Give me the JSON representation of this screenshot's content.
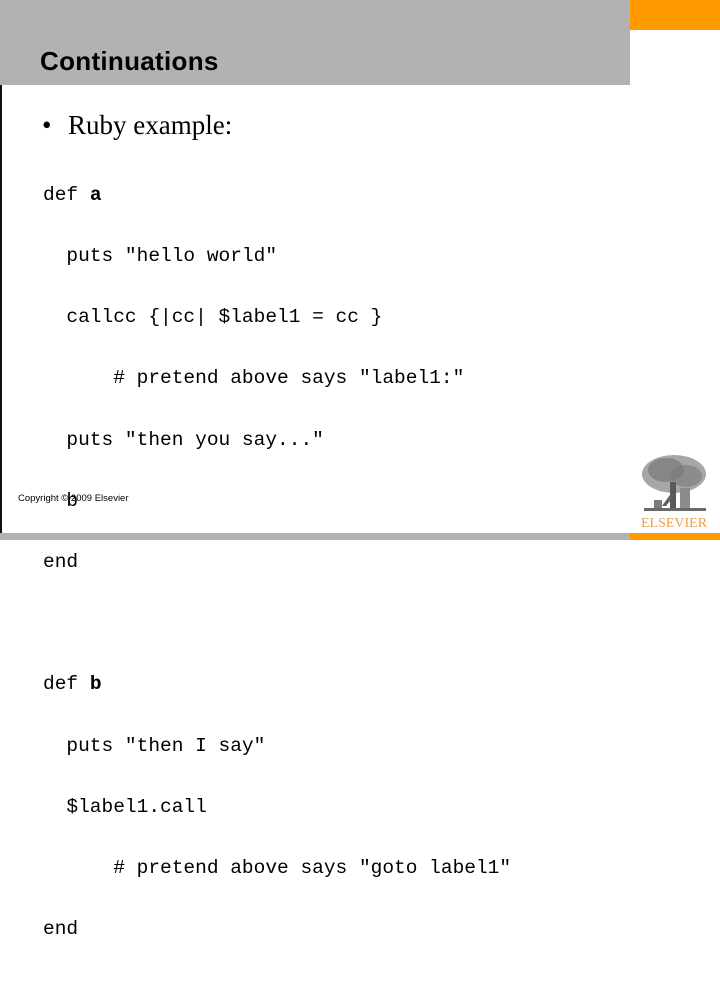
{
  "slide": {
    "title": "Continuations",
    "bullet": {
      "marker": "•",
      "text": "Ruby example:"
    },
    "code": {
      "block1": [
        {
          "pre": "def ",
          "bold": "a",
          "post": ""
        },
        {
          "pre": "  puts \"hello world\"",
          "bold": "",
          "post": ""
        },
        {
          "pre": "  callcc {|cc| $label1 = cc }",
          "bold": "",
          "post": ""
        },
        {
          "pre": "      # pretend above says \"label1:\"",
          "bold": "",
          "post": ""
        },
        {
          "pre": "  puts \"then you say...\"",
          "bold": "",
          "post": ""
        },
        {
          "pre": "  b",
          "bold": "",
          "post": ""
        },
        {
          "pre": "end",
          "bold": "",
          "post": ""
        }
      ],
      "block2": [
        {
          "pre": "def ",
          "bold": "b",
          "post": ""
        },
        {
          "pre": "  puts \"then I say\"",
          "bold": "",
          "post": ""
        },
        {
          "pre": "  $label1.call",
          "bold": "",
          "post": ""
        },
        {
          "pre": "      # pretend above says \"goto label1\"",
          "bold": "",
          "post": ""
        },
        {
          "pre": "end",
          "bold": "",
          "post": ""
        }
      ]
    },
    "copyright": "Copyright © 2009 Elsevier",
    "logo": {
      "icon": "elsevier-tree-icon",
      "text": "ELSEVIER"
    },
    "colors": {
      "title_bar": "#b2b2b4",
      "accent": "#ff9a00",
      "logo_text": "#e8a04a"
    }
  }
}
